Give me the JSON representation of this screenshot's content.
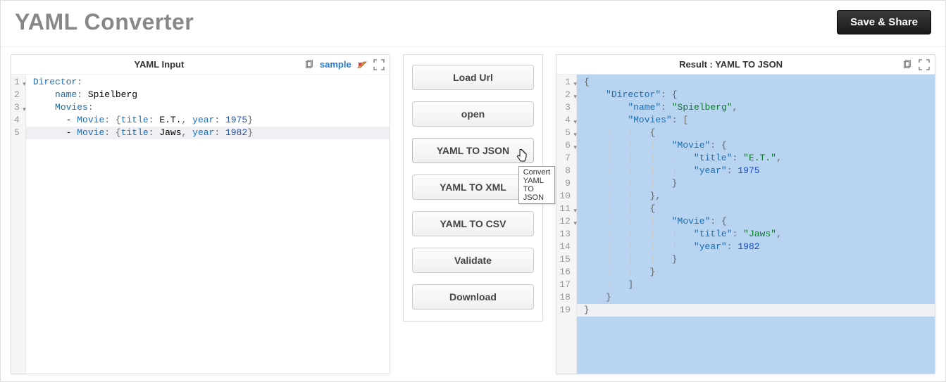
{
  "header": {
    "title": "YAML Converter",
    "save_share": "Save & Share"
  },
  "panels": {
    "input": {
      "title": "YAML Input",
      "sample_label": "sample",
      "lines": [
        {
          "n": "1",
          "fold": true,
          "html": "<span class='tok-yamlkey'>Director</span><span class='tok-punc'>:</span>"
        },
        {
          "n": "2",
          "fold": false,
          "html": "    <span class='tok-yamlkey'>name</span><span class='tok-punc'>:</span> Spielberg"
        },
        {
          "n": "3",
          "fold": true,
          "html": "    <span class='tok-yamlkey'>Movies</span><span class='tok-punc'>:</span>"
        },
        {
          "n": "4",
          "fold": false,
          "html": "      - <span class='tok-yamlkey'>Movie</span><span class='tok-punc'>:</span> <span class='tok-punc'>{</span><span class='tok-yamlattr'>title</span><span class='tok-punc'>:</span> E.T.<span class='tok-punc'>,</span> <span class='tok-yamlattr'>year</span><span class='tok-punc'>:</span> <span class='tok-num'>1975</span><span class='tok-punc'>}</span>"
        },
        {
          "n": "5",
          "fold": false,
          "hl": true,
          "html": "      - <span class='tok-yamlkey'>Movie</span><span class='tok-punc'>:</span> <span class='tok-punc'>{</span><span class='tok-yamlattr'>title</span><span class='tok-punc'>:</span> Jaws<span class='tok-punc'>,</span> <span class='tok-yamlattr'>year</span><span class='tok-punc'>:</span> <span class='tok-num'>1982</span><span class='tok-punc'>}</span>"
        }
      ]
    },
    "output": {
      "title": "Result : YAML TO JSON",
      "lines": [
        {
          "n": "1",
          "fold": true,
          "html": "<span class='tok-punc'>{</span>"
        },
        {
          "n": "2",
          "fold": true,
          "html": "    <span class='tok-key'>\"Director\"</span><span class='tok-punc'>:</span> <span class='tok-punc'>{</span>"
        },
        {
          "n": "3",
          "fold": false,
          "html": "        <span class='tok-key'>\"name\"</span><span class='tok-punc'>:</span> <span class='tok-str'>\"Spielberg\"</span><span class='tok-punc'>,</span>"
        },
        {
          "n": "4",
          "fold": true,
          "html": "        <span class='tok-key'>\"Movies\"</span><span class='tok-punc'>:</span> <span class='tok-punc'>[</span>"
        },
        {
          "n": "5",
          "fold": true,
          "html": "<span class='indent-guide'>    |   |   </span><span class='tok-punc'>{</span>"
        },
        {
          "n": "6",
          "fold": true,
          "html": "<span class='indent-guide'>    |   |   |   </span><span class='tok-key'>\"Movie\"</span><span class='tok-punc'>:</span> <span class='tok-punc'>{</span>"
        },
        {
          "n": "7",
          "fold": false,
          "html": "<span class='indent-guide'>    |   |   |   |   </span><span class='tok-key'>\"title\"</span><span class='tok-punc'>:</span> <span class='tok-str'>\"E.T.\"</span><span class='tok-punc'>,</span>"
        },
        {
          "n": "8",
          "fold": false,
          "html": "<span class='indent-guide'>    |   |   |   |   </span><span class='tok-key'>\"year\"</span><span class='tok-punc'>:</span> <span class='tok-num'>1975</span>"
        },
        {
          "n": "9",
          "fold": false,
          "html": "<span class='indent-guide'>    |   |   |   </span><span class='tok-punc'>}</span>"
        },
        {
          "n": "10",
          "fold": false,
          "html": "<span class='indent-guide'>    |   |   </span><span class='tok-punc'>},</span>"
        },
        {
          "n": "11",
          "fold": true,
          "html": "<span class='indent-guide'>    |   |   </span><span class='tok-punc'>{</span>"
        },
        {
          "n": "12",
          "fold": true,
          "html": "<span class='indent-guide'>    |   |   |   </span><span class='tok-key'>\"Movie\"</span><span class='tok-punc'>:</span> <span class='tok-punc'>{</span>"
        },
        {
          "n": "13",
          "fold": false,
          "html": "<span class='indent-guide'>    |   |   |   |   </span><span class='tok-key'>\"title\"</span><span class='tok-punc'>:</span> <span class='tok-str'>\"Jaws\"</span><span class='tok-punc'>,</span>"
        },
        {
          "n": "14",
          "fold": false,
          "html": "<span class='indent-guide'>    |   |   |   |   </span><span class='tok-key'>\"year\"</span><span class='tok-punc'>:</span> <span class='tok-num'>1982</span>"
        },
        {
          "n": "15",
          "fold": false,
          "html": "<span class='indent-guide'>    |   |   |   </span><span class='tok-punc'>}</span>"
        },
        {
          "n": "16",
          "fold": false,
          "html": "<span class='indent-guide'>    |   |   </span><span class='tok-punc'>}</span>"
        },
        {
          "n": "17",
          "fold": false,
          "html": "<span class='indent-guide'>    |   </span><span class='tok-punc'>]</span>"
        },
        {
          "n": "18",
          "fold": false,
          "html": "<span class='indent-guide'>    </span><span class='tok-punc'>}</span>"
        },
        {
          "n": "19",
          "fold": false,
          "last": true,
          "html": "<span class='tok-punc'>}</span>"
        }
      ]
    }
  },
  "center": {
    "buttons": [
      {
        "id": "load_url",
        "label": "Load Url"
      },
      {
        "id": "open",
        "label": "open"
      },
      {
        "id": "yaml_to_json",
        "label": "YAML TO JSON"
      },
      {
        "id": "yaml_to_xml",
        "label": "YAML TO XML"
      },
      {
        "id": "yaml_to_csv",
        "label": "YAML TO CSV"
      },
      {
        "id": "validate",
        "label": "Validate"
      },
      {
        "id": "download",
        "label": "Download"
      }
    ]
  },
  "tooltip": {
    "text": "Convert YAML TO JSON"
  }
}
